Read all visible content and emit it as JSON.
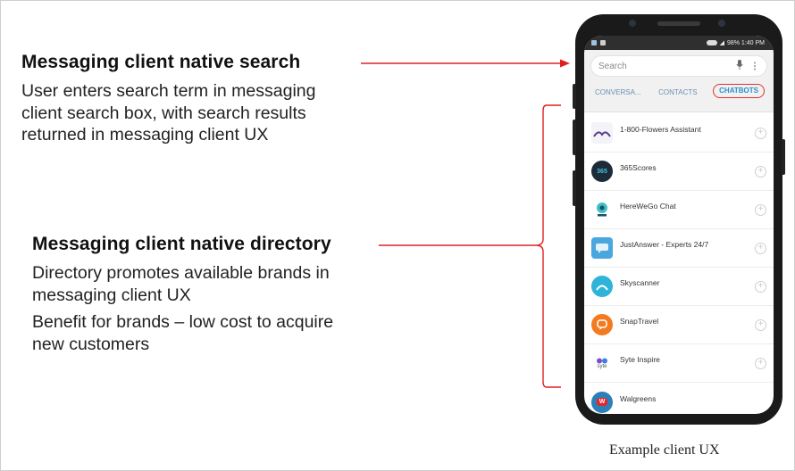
{
  "annotations": {
    "search": {
      "heading": "Messaging client native search",
      "lines": [
        "User enters search term in messaging",
        "client search box, with search results",
        "returned in messaging client UX"
      ]
    },
    "directory": {
      "heading": "Messaging client native directory",
      "lines": [
        "Directory promotes available brands in",
        "messaging client UX",
        "Benefit for brands – low cost to acquire",
        "new customers"
      ]
    }
  },
  "caption": "Example client UX",
  "phone": {
    "status": {
      "right_text": "98%  1:40 PM"
    },
    "search_placeholder": "Search",
    "tabs": [
      {
        "label": "CONVERSA...",
        "active": false
      },
      {
        "label": "CONTACTS",
        "active": false
      },
      {
        "label": "CHATBOTS",
        "active": true
      }
    ],
    "bots": [
      {
        "name": "1-800-Flowers Assistant",
        "icon": "flowers-logo",
        "avatar_text": "",
        "color": "#f3f3f8"
      },
      {
        "name": "365Scores",
        "icon": "365scores-logo",
        "avatar_text": "365",
        "color": "#1c2a3a"
      },
      {
        "name": "HereWeGo Chat",
        "icon": "herewego-logo",
        "avatar_text": "",
        "color": "#ffffff"
      },
      {
        "name": "JustAnswer - Experts 24/7",
        "icon": "justanswer-logo",
        "avatar_text": "",
        "color": "#4aa6de"
      },
      {
        "name": "Skyscanner",
        "icon": "skyscanner-logo",
        "avatar_text": "",
        "color": "#2fb3d9"
      },
      {
        "name": "SnapTravel",
        "icon": "snaptravel-logo",
        "avatar_text": "",
        "color": "#f47a20"
      },
      {
        "name": "Syte Inspire",
        "icon": "syte-logo",
        "avatar_text": "syte",
        "color": "#ffffff"
      },
      {
        "name": "Walgreens",
        "icon": "walgreens-logo",
        "avatar_text": "W",
        "color": "#2d7fb8"
      }
    ]
  },
  "colors": {
    "arrow": "#e02020",
    "tab_active": "#2a8fd0",
    "status_bar": "#2f2f2f"
  }
}
